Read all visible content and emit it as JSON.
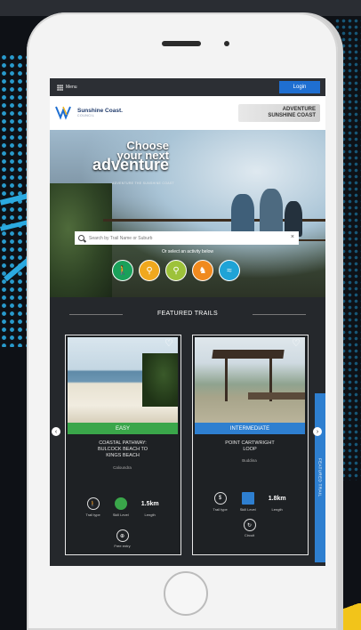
{
  "app": {
    "menu_label": "Menu",
    "login_label": "Login"
  },
  "logos": {
    "council_name": "Sunshine Coast.",
    "council_sub": "COUNCIL",
    "adventure_line1": "ADVENTURE",
    "adventure_line2": "SUNSHINE COAST"
  },
  "hero": {
    "title_line1": "Choose",
    "title_line2": "your next",
    "title_line3": "adventure",
    "subtitle": "ADVENTURE THE SUNSHINE COAST",
    "search_placeholder": "Search by Trail Name or Suburb",
    "clear_symbol": "×",
    "activity_prompt": "Or select an activity below",
    "activities": [
      {
        "name": "walking",
        "icon": "walking-icon",
        "glyph": "🚶",
        "color": "#1aa05a"
      },
      {
        "name": "cycling",
        "icon": "cycling-icon",
        "glyph": "⚲",
        "color": "#f0a81e"
      },
      {
        "name": "mountain-biking",
        "icon": "mountain-bike-icon",
        "glyph": "⚲",
        "color": "#9dc23a"
      },
      {
        "name": "horse-riding",
        "icon": "horse-icon",
        "glyph": "♞",
        "color": "#f08a1e"
      },
      {
        "name": "paddling",
        "icon": "kayak-icon",
        "glyph": "≈",
        "color": "#1fa3d6"
      }
    ]
  },
  "featured": {
    "title": "FEATURED TRAILS",
    "cards": [
      {
        "difficulty": "EASY",
        "difficulty_color": "#3aa64a",
        "name_line1": "COASTAL PATHWAY:",
        "name_line2": "BULCOCK BEACH TO",
        "name_line3": "KINGS BEACH",
        "location": "Caloundra",
        "trail_type_label": "Trail type",
        "skill_label": "Skill Level",
        "length_value": "1.5km",
        "length_label": "Length",
        "extra_label": "Free entry",
        "skill_color": "#3aa64a"
      },
      {
        "difficulty": "INTERMEDIATE",
        "difficulty_color": "#2e7fd0",
        "name_line1": "POINT CARTWRIGHT",
        "name_line2": "LOOP",
        "location": "Buddina",
        "trail_type_label": "Trail type",
        "skill_label": "Skill Level",
        "length_value": "1.8km",
        "length_label": "Length",
        "extra_label": "Circuit",
        "skill_color": "#2e7fd0"
      }
    ],
    "side_tab": "FEATURED TRAIL"
  }
}
